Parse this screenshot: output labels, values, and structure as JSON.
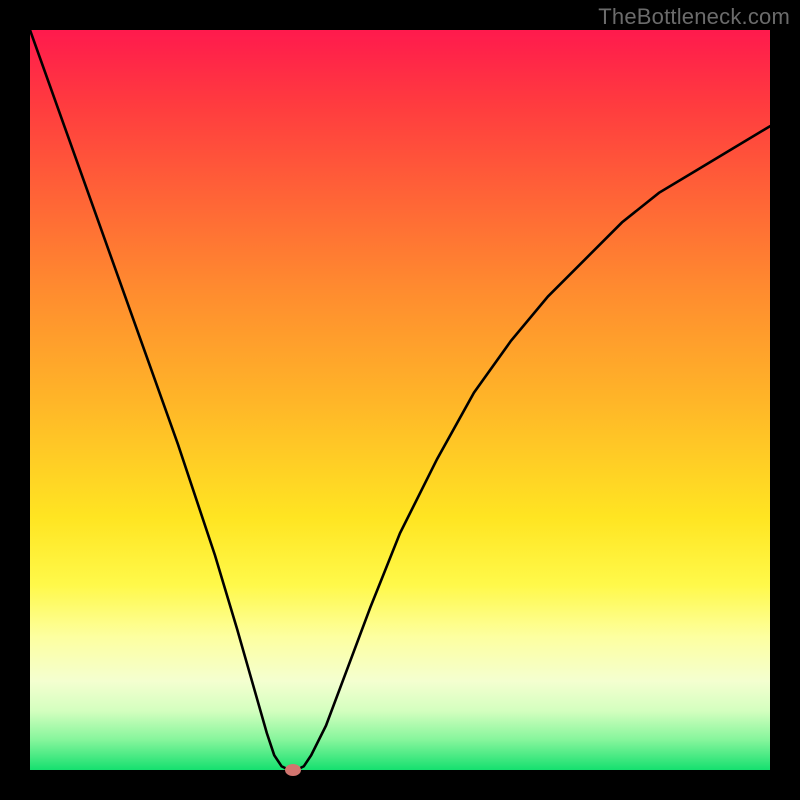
{
  "watermark": "TheBottleneck.com",
  "chart_data": {
    "type": "line",
    "title": "",
    "xlabel": "",
    "ylabel": "",
    "xlim": [
      0,
      100
    ],
    "ylim": [
      0,
      100
    ],
    "grid": false,
    "series": [
      {
        "name": "curve",
        "x": [
          0,
          5,
          10,
          15,
          20,
          25,
          28,
          30,
          32,
          33,
          34,
          35,
          36,
          37,
          38,
          40,
          43,
          46,
          50,
          55,
          60,
          65,
          70,
          75,
          80,
          85,
          90,
          95,
          100
        ],
        "y": [
          100,
          86,
          72,
          58,
          44,
          29,
          19,
          12,
          5,
          2,
          0.5,
          0,
          0,
          0.5,
          2,
          6,
          14,
          22,
          32,
          42,
          51,
          58,
          64,
          69,
          74,
          78,
          81,
          84,
          87
        ]
      }
    ],
    "marker": {
      "x": 35.5,
      "y": 0
    },
    "background_gradient": {
      "top": "#ff1a4d",
      "bottom": "#15e06f"
    }
  }
}
